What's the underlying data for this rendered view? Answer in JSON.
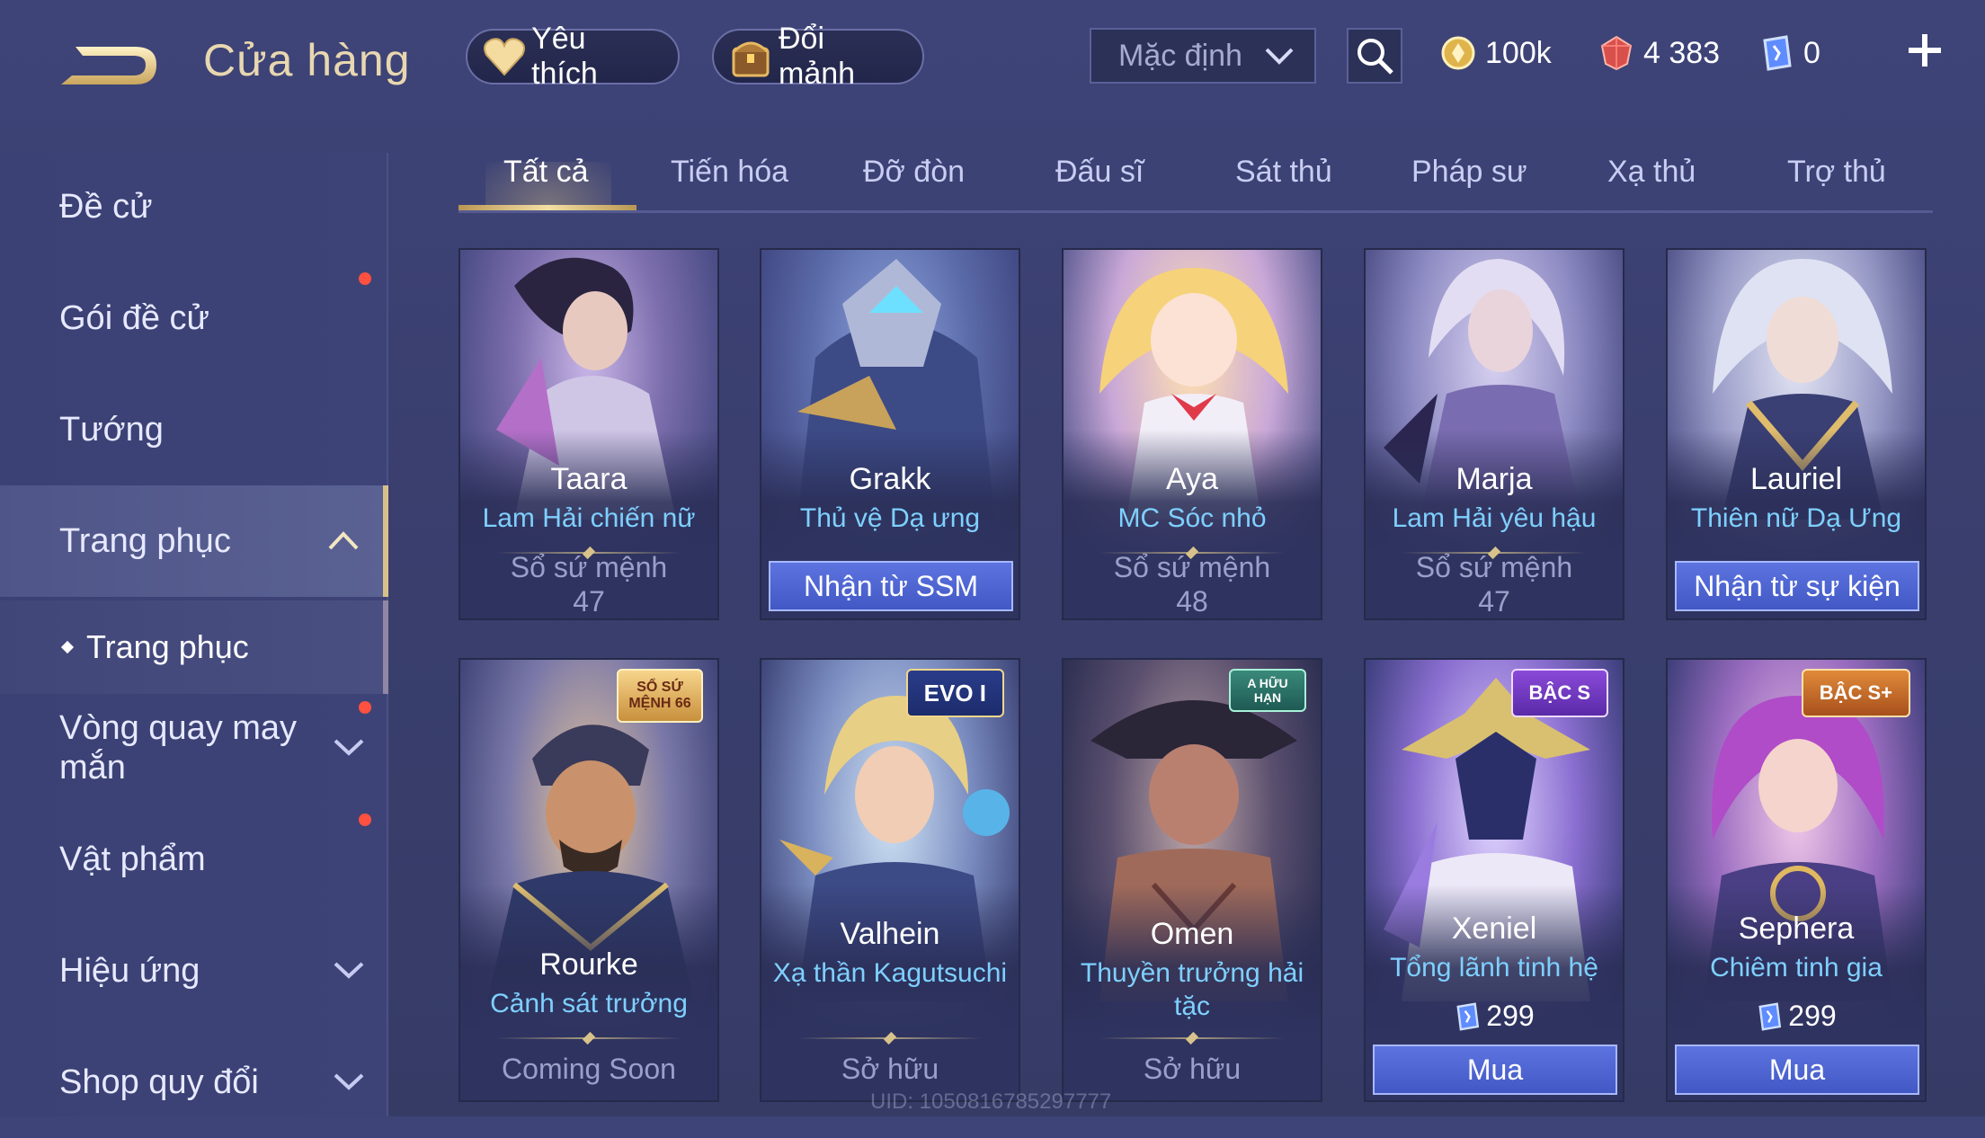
{
  "header": {
    "title": "Cửa hàng",
    "favorites_label": "Yêu thích",
    "exchange_label": "Đổi mảnh",
    "sort_value": "Mặc định",
    "currencies": [
      {
        "icon": "gold-coin-icon",
        "value": "100k"
      },
      {
        "icon": "ruby-gem-icon",
        "value": "4 383"
      },
      {
        "icon": "voucher-icon",
        "value": "0"
      }
    ]
  },
  "sidebar": {
    "items": [
      {
        "label": "Đề cử"
      },
      {
        "label": "Gói đề cử"
      },
      {
        "label": "Tướng"
      },
      {
        "label": "Trang phục"
      },
      {
        "label": "Vòng quay may mắn"
      },
      {
        "label": "Vật phẩm"
      },
      {
        "label": "Hiệu ứng"
      },
      {
        "label": "Shop quy đổi"
      }
    ],
    "subitem": "Trang phục"
  },
  "tabs": [
    "Tất cả",
    "Tiến hóa",
    "Đỡ đòn",
    "Đấu sĩ",
    "Sát thủ",
    "Pháp sư",
    "Xạ thủ",
    "Trợ thủ"
  ],
  "cards": [
    {
      "hero": "Taara",
      "skin": "Lam Hải chiến nữ",
      "status": "Sổ sứ mệnh",
      "status2": "47"
    },
    {
      "hero": "Grakk",
      "skin": "Thủ vệ Dạ ưng",
      "button": "Nhận từ SSM"
    },
    {
      "hero": "Aya",
      "skin": "MC Sóc nhỏ",
      "status": "Sổ sứ mệnh",
      "status2": "48"
    },
    {
      "hero": "Marja",
      "skin": "Lam Hải yêu hậu",
      "status": "Sổ sứ mệnh",
      "status2": "47"
    },
    {
      "hero": "Lauriel",
      "skin": "Thiên nữ Dạ Ưng",
      "button": "Nhận từ sự kiện"
    },
    {
      "hero": "Rourke",
      "skin": "Cảnh sát trưởng",
      "status": "Coming Soon",
      "badge": "SỔ SỨ MỆNH 66"
    },
    {
      "hero": "Valhein",
      "skin": "Xạ thần Kagutsuchi",
      "status": "Sở hữu",
      "badge": "EVO I"
    },
    {
      "hero": "Omen",
      "skin": "Thuyền trưởng hải tặc",
      "status": "Sở hữu",
      "badge": "A HỮU HẠN"
    },
    {
      "hero": "Xeniel",
      "skin": "Tổng lãnh tinh hệ",
      "price": "299",
      "button": "Mua",
      "badge": "BẬC S"
    },
    {
      "hero": "Sephera",
      "skin": "Chiêm tinh gia",
      "price": "299",
      "button": "Mua",
      "badge": "BẬC S+"
    }
  ],
  "uid": "UID: 1050816785297777"
}
